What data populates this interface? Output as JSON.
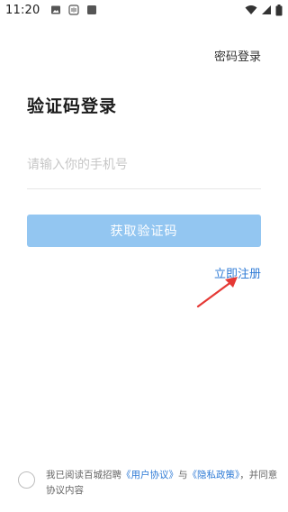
{
  "status_bar": {
    "time": "11:20",
    "left_icons": [
      "image-icon",
      "nfc-icon",
      "app-square-icon"
    ],
    "right_icons": [
      "wifi-icon",
      "signal-icon",
      "battery-icon"
    ]
  },
  "header": {
    "password_login_label": "密码登录"
  },
  "main": {
    "title": "验证码登录",
    "phone_placeholder": "请输入你的手机号",
    "phone_value": "",
    "get_code_label": "获取验证码",
    "register_label": "立即注册"
  },
  "agreement": {
    "checked": false,
    "prefix": "我已阅读百城招聘",
    "user_agreement": "《用户协议》",
    "and": "与",
    "privacy_policy": "《隐私政策》",
    "suffix": "，并同意协议内容"
  },
  "colors": {
    "accent": "#2f7bd6",
    "button_disabled": "#93c6f1",
    "annotation_arrow": "#e53935"
  }
}
